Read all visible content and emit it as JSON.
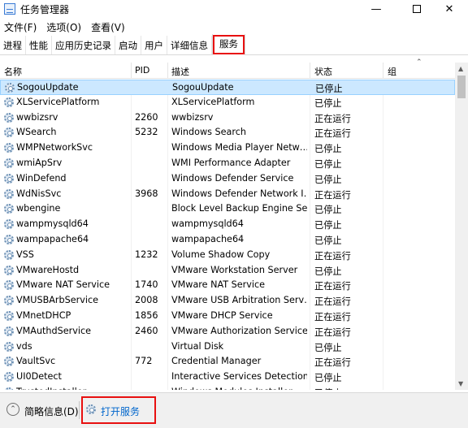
{
  "window": {
    "title": "任务管理器"
  },
  "menu": [
    "文件(F)",
    "选项(O)",
    "查看(V)"
  ],
  "tabs": [
    "进程",
    "性能",
    "应用历史记录",
    "启动",
    "用户",
    "详细信息",
    "服务"
  ],
  "columns": {
    "name": "名称",
    "pid": "PID",
    "desc": "描述",
    "status": "状态",
    "group": "组"
  },
  "services": [
    {
      "name": "SogouUpdate",
      "pid": "",
      "desc": "SogouUpdate",
      "status": "已停止"
    },
    {
      "name": "XLServicePlatform",
      "pid": "",
      "desc": "XLServicePlatform",
      "status": "已停止"
    },
    {
      "name": "wwbizsrv",
      "pid": "2260",
      "desc": "wwbizsrv",
      "status": "正在运行"
    },
    {
      "name": "WSearch",
      "pid": "5232",
      "desc": "Windows Search",
      "status": "正在运行"
    },
    {
      "name": "WMPNetworkSvc",
      "pid": "",
      "desc": "Windows Media Player Netw…",
      "status": "已停止"
    },
    {
      "name": "wmiApSrv",
      "pid": "",
      "desc": "WMI Performance Adapter",
      "status": "已停止"
    },
    {
      "name": "WinDefend",
      "pid": "",
      "desc": "Windows Defender Service",
      "status": "已停止"
    },
    {
      "name": "WdNisSvc",
      "pid": "3968",
      "desc": "Windows Defender Network I…",
      "status": "正在运行"
    },
    {
      "name": "wbengine",
      "pid": "",
      "desc": "Block Level Backup Engine Se…",
      "status": "已停止"
    },
    {
      "name": "wampmysqld64",
      "pid": "",
      "desc": "wampmysqld64",
      "status": "已停止"
    },
    {
      "name": "wampapache64",
      "pid": "",
      "desc": "wampapache64",
      "status": "已停止"
    },
    {
      "name": "VSS",
      "pid": "1232",
      "desc": "Volume Shadow Copy",
      "status": "正在运行"
    },
    {
      "name": "VMwareHostd",
      "pid": "",
      "desc": "VMware Workstation Server",
      "status": "已停止"
    },
    {
      "name": "VMware NAT Service",
      "pid": "1740",
      "desc": "VMware NAT Service",
      "status": "正在运行"
    },
    {
      "name": "VMUSBArbService",
      "pid": "2008",
      "desc": "VMware USB Arbitration Serv…",
      "status": "正在运行"
    },
    {
      "name": "VMnetDHCP",
      "pid": "1856",
      "desc": "VMware DHCP Service",
      "status": "正在运行"
    },
    {
      "name": "VMAuthdService",
      "pid": "2460",
      "desc": "VMware Authorization Service",
      "status": "正在运行"
    },
    {
      "name": "vds",
      "pid": "",
      "desc": "Virtual Disk",
      "status": "已停止"
    },
    {
      "name": "VaultSvc",
      "pid": "772",
      "desc": "Credential Manager",
      "status": "正在运行"
    },
    {
      "name": "UI0Detect",
      "pid": "",
      "desc": "Interactive Services Detection",
      "status": "已停止"
    },
    {
      "name": "TrustedInstaller",
      "pid": "",
      "desc": "Windows Modules Installer",
      "status": "已停止"
    }
  ],
  "selected_index": 0,
  "footer": {
    "fewer_details": "简略信息(D)",
    "open_services": "打开服务"
  }
}
